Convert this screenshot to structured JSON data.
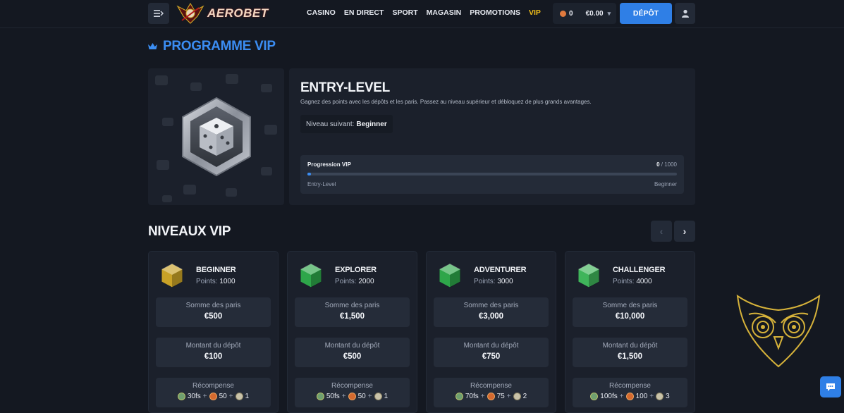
{
  "header": {
    "brand": "AEROBET",
    "nav": [
      "CASINO",
      "EN DIRECT",
      "SPORT",
      "MAGASIN",
      "PROMOTIONS",
      "VIP"
    ],
    "active_nav": "VIP",
    "coins": "0",
    "balance": "€0.00",
    "deposit_label": "DÉPÔT"
  },
  "page": {
    "title": "PROGRAMME VIP"
  },
  "current_level": {
    "name": "ENTRY-LEVEL",
    "description": "Gagnez des points avec les dépôts et les paris. Passez au niveau supérieur et débloquez de plus grands avantages.",
    "next_level_label": "Niveau suivant:",
    "next_level_value": "Beginner",
    "progress_label": "Progression VIP",
    "progress_current": "0",
    "progress_total": "/ 1000",
    "progress_fraction": 0.01,
    "progress_from": "Entry-Level",
    "progress_to": "Beginner"
  },
  "levels": {
    "title": "NIVEAUX VIP",
    "points_label": "Points:",
    "bets_label": "Somme des paris",
    "deposit_label": "Montant du dépôt",
    "reward_label": "Récompense",
    "cards": [
      {
        "name": "BEGINNER",
        "points": "1000",
        "bets": "€500",
        "deposit": "€100",
        "fs": "30fs",
        "pts": "50",
        "box": "1",
        "gem_color": "#c9a227"
      },
      {
        "name": "EXPLORER",
        "points": "2000",
        "bets": "€1,500",
        "deposit": "€500",
        "fs": "50fs",
        "pts": "50",
        "box": "1",
        "gem_color": "#2ea64a"
      },
      {
        "name": "ADVENTURER",
        "points": "3000",
        "bets": "€3,000",
        "deposit": "€750",
        "fs": "70fs",
        "pts": "75",
        "box": "2",
        "gem_color": "#2ea64a"
      },
      {
        "name": "CHALLENGER",
        "points": "4000",
        "bets": "€10,000",
        "deposit": "€1,500",
        "fs": "100fs",
        "pts": "100",
        "box": "3",
        "gem_color": "#3fb55a"
      }
    ]
  },
  "colors": {
    "accent": "#3b8df2",
    "vip_active": "#f3c01a",
    "background": "#141821"
  },
  "icons": {
    "menu": "menu-toggle-icon",
    "user": "user-icon",
    "chat": "chat-support-icon",
    "watermark": "owl-logo"
  }
}
